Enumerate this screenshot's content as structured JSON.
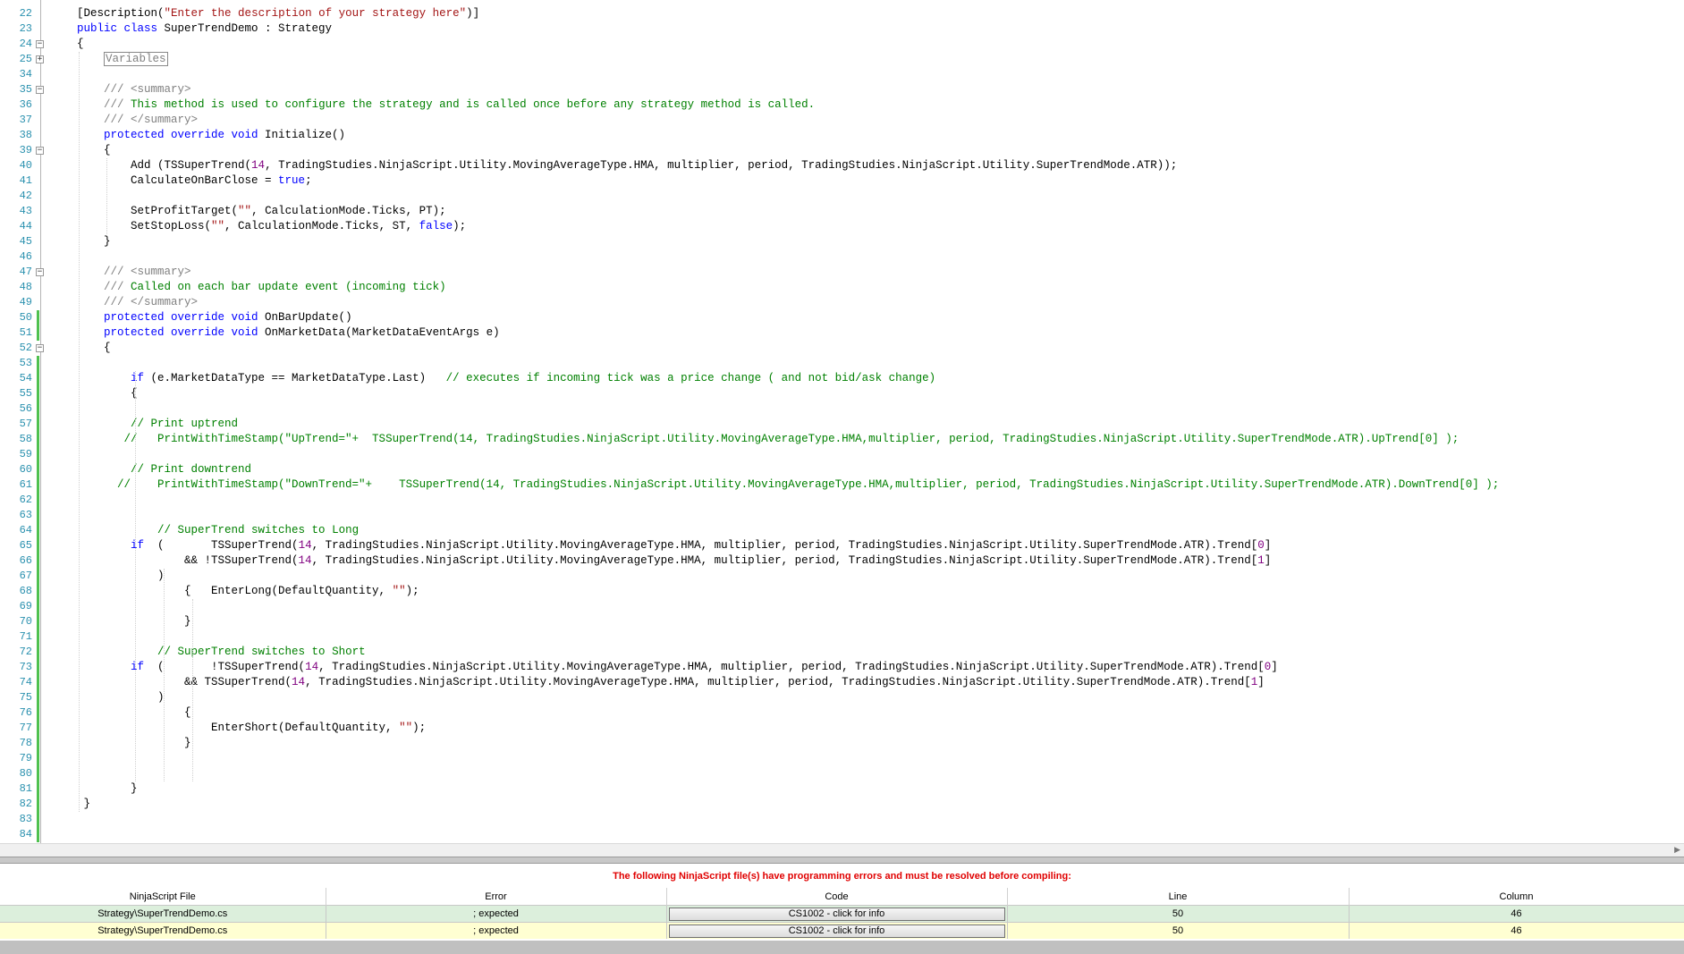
{
  "editor": {
    "lines": [
      {
        "n": "22",
        "parts": [
          [
            "",
            "    "
          ],
          [
            "",
            "[Description("
          ],
          [
            "st",
            "\"Enter the description of your strategy here\""
          ],
          [
            "",
            ")]"
          ]
        ]
      },
      {
        "n": "23",
        "parts": [
          [
            "",
            "    "
          ],
          [
            "kw",
            "public class"
          ],
          [
            "",
            " SuperTrendDemo : Strategy"
          ]
        ]
      },
      {
        "n": "24",
        "parts": [
          [
            "",
            "    {"
          ]
        ]
      },
      {
        "n": "25",
        "region": "Variables",
        "parts": [
          [
            "",
            "        "
          ]
        ]
      },
      {
        "n": "34",
        "parts": [
          [
            "",
            ""
          ]
        ]
      },
      {
        "n": "35",
        "parts": [
          [
            "",
            "        "
          ],
          [
            "gray",
            "/// <summary>"
          ]
        ]
      },
      {
        "n": "36",
        "parts": [
          [
            "",
            "        "
          ],
          [
            "gray",
            "/// "
          ],
          [
            "cm",
            "This method is used to configure the strategy and is called once before any strategy method is called."
          ]
        ]
      },
      {
        "n": "37",
        "parts": [
          [
            "",
            "        "
          ],
          [
            "gray",
            "/// </summary>"
          ]
        ]
      },
      {
        "n": "38",
        "parts": [
          [
            "",
            "        "
          ],
          [
            "kw",
            "protected override void"
          ],
          [
            "",
            " Initialize()"
          ]
        ]
      },
      {
        "n": "39",
        "parts": [
          [
            "",
            "        {"
          ]
        ]
      },
      {
        "n": "40",
        "parts": [
          [
            "",
            "            Add (TSSuperTrend("
          ],
          [
            "nm",
            "14"
          ],
          [
            "",
            ", TradingStudies.NinjaScript.Utility.MovingAverageType.HMA, multiplier, period, TradingStudies.NinjaScript.Utility.SuperTrendMode.ATR));"
          ]
        ]
      },
      {
        "n": "41",
        "parts": [
          [
            "",
            "            CalculateOnBarClose = "
          ],
          [
            "kw",
            "true"
          ],
          [
            "",
            ";"
          ]
        ]
      },
      {
        "n": "42",
        "parts": [
          [
            "",
            ""
          ]
        ]
      },
      {
        "n": "43",
        "parts": [
          [
            "",
            "            SetProfitTarget("
          ],
          [
            "st",
            "\"\""
          ],
          [
            "",
            ", CalculationMode.Ticks, PT);"
          ]
        ]
      },
      {
        "n": "44",
        "parts": [
          [
            "",
            "            SetStopLoss("
          ],
          [
            "st",
            "\"\""
          ],
          [
            "",
            ", CalculationMode.Ticks, ST, "
          ],
          [
            "kw",
            "false"
          ],
          [
            "",
            ");"
          ]
        ]
      },
      {
        "n": "45",
        "parts": [
          [
            "",
            "        }"
          ]
        ]
      },
      {
        "n": "46",
        "parts": [
          [
            "",
            ""
          ]
        ]
      },
      {
        "n": "47",
        "parts": [
          [
            "",
            "        "
          ],
          [
            "gray",
            "/// <summary>"
          ]
        ]
      },
      {
        "n": "48",
        "parts": [
          [
            "",
            "        "
          ],
          [
            "gray",
            "/// "
          ],
          [
            "cm",
            "Called on each bar update event (incoming tick)"
          ]
        ]
      },
      {
        "n": "49",
        "parts": [
          [
            "",
            "        "
          ],
          [
            "gray",
            "/// </summary>"
          ]
        ]
      },
      {
        "n": "50",
        "parts": [
          [
            "",
            "        "
          ],
          [
            "kw",
            "protected override void"
          ],
          [
            "",
            " OnBarUpdate()"
          ]
        ]
      },
      {
        "n": "51",
        "parts": [
          [
            "",
            "        "
          ],
          [
            "kw",
            "protected override void"
          ],
          [
            "",
            " OnMarketData(MarketDataEventArgs e)"
          ]
        ]
      },
      {
        "n": "52",
        "parts": [
          [
            "",
            "        {"
          ]
        ]
      },
      {
        "n": "53",
        "parts": [
          [
            "",
            ""
          ]
        ]
      },
      {
        "n": "54",
        "parts": [
          [
            "",
            "            "
          ],
          [
            "kw",
            "if"
          ],
          [
            "",
            " (e.MarketDataType == MarketDataType.Last)   "
          ],
          [
            "cm",
            "// executes if incoming tick was a price change ( and not bid/ask change)"
          ]
        ]
      },
      {
        "n": "55",
        "parts": [
          [
            "",
            "            {"
          ]
        ]
      },
      {
        "n": "56",
        "parts": [
          [
            "",
            ""
          ]
        ]
      },
      {
        "n": "57",
        "parts": [
          [
            "",
            "            "
          ],
          [
            "cm",
            "// Print uptrend"
          ]
        ]
      },
      {
        "n": "58",
        "parts": [
          [
            "",
            "           "
          ],
          [
            "cm",
            "//   PrintWithTimeStamp(\"UpTrend=\"+  TSSuperTrend(14, TradingStudies.NinjaScript.Utility.MovingAverageType.HMA,multiplier, period, TradingStudies.NinjaScript.Utility.SuperTrendMode.ATR).UpTrend[0] );"
          ]
        ]
      },
      {
        "n": "59",
        "parts": [
          [
            "",
            ""
          ]
        ]
      },
      {
        "n": "60",
        "parts": [
          [
            "",
            "            "
          ],
          [
            "cm",
            "// Print downtrend"
          ]
        ]
      },
      {
        "n": "61",
        "parts": [
          [
            "",
            "          "
          ],
          [
            "cm",
            "//    PrintWithTimeStamp(\"DownTrend=\"+    TSSuperTrend(14, TradingStudies.NinjaScript.Utility.MovingAverageType.HMA,multiplier, period, TradingStudies.NinjaScript.Utility.SuperTrendMode.ATR).DownTrend[0] );"
          ]
        ]
      },
      {
        "n": "62",
        "parts": [
          [
            "",
            ""
          ]
        ]
      },
      {
        "n": "63",
        "parts": [
          [
            "",
            ""
          ]
        ]
      },
      {
        "n": "64",
        "parts": [
          [
            "",
            "                "
          ],
          [
            "cm",
            "// SuperTrend switches to Long"
          ]
        ]
      },
      {
        "n": "65",
        "parts": [
          [
            "",
            "            "
          ],
          [
            "kw",
            "if"
          ],
          [
            "",
            "  (       TSSuperTrend("
          ],
          [
            "nm",
            "14"
          ],
          [
            "",
            ", TradingStudies.NinjaScript.Utility.MovingAverageType.HMA, multiplier, period, TradingStudies.NinjaScript.Utility.SuperTrendMode.ATR).Trend["
          ],
          [
            "nm",
            "0"
          ],
          [
            "",
            "]"
          ]
        ]
      },
      {
        "n": "66",
        "parts": [
          [
            "",
            "                    && !TSSuperTrend("
          ],
          [
            "nm",
            "14"
          ],
          [
            "",
            ", TradingStudies.NinjaScript.Utility.MovingAverageType.HMA, multiplier, period, TradingStudies.NinjaScript.Utility.SuperTrendMode.ATR).Trend["
          ],
          [
            "nm",
            "1"
          ],
          [
            "",
            "]"
          ]
        ]
      },
      {
        "n": "67",
        "parts": [
          [
            "",
            "                )"
          ]
        ]
      },
      {
        "n": "68",
        "parts": [
          [
            "",
            "                    {   EnterLong(DefaultQuantity, "
          ],
          [
            "st",
            "\"\""
          ],
          [
            "",
            ");"
          ]
        ]
      },
      {
        "n": "69",
        "parts": [
          [
            "",
            ""
          ]
        ]
      },
      {
        "n": "70",
        "parts": [
          [
            "",
            "                    }"
          ]
        ]
      },
      {
        "n": "71",
        "parts": [
          [
            "",
            ""
          ]
        ]
      },
      {
        "n": "72",
        "parts": [
          [
            "",
            "                "
          ],
          [
            "cm",
            "// SuperTrend switches to Short"
          ]
        ]
      },
      {
        "n": "73",
        "parts": [
          [
            "",
            "            "
          ],
          [
            "kw",
            "if"
          ],
          [
            "",
            "  (       !TSSuperTrend("
          ],
          [
            "nm",
            "14"
          ],
          [
            "",
            ", TradingStudies.NinjaScript.Utility.MovingAverageType.HMA, multiplier, period, TradingStudies.NinjaScript.Utility.SuperTrendMode.ATR).Trend["
          ],
          [
            "nm",
            "0"
          ],
          [
            "",
            "]"
          ]
        ]
      },
      {
        "n": "74",
        "parts": [
          [
            "",
            "                    && TSSuperTrend("
          ],
          [
            "nm",
            "14"
          ],
          [
            "",
            ", TradingStudies.NinjaScript.Utility.MovingAverageType.HMA, multiplier, period, TradingStudies.NinjaScript.Utility.SuperTrendMode.ATR).Trend["
          ],
          [
            "nm",
            "1"
          ],
          [
            "",
            "]"
          ]
        ]
      },
      {
        "n": "75",
        "parts": [
          [
            "",
            "                )"
          ]
        ]
      },
      {
        "n": "76",
        "parts": [
          [
            "",
            "                    {"
          ]
        ]
      },
      {
        "n": "77",
        "parts": [
          [
            "",
            "                        EnterShort(DefaultQuantity, "
          ],
          [
            "st",
            "\"\""
          ],
          [
            "",
            ");"
          ]
        ]
      },
      {
        "n": "78",
        "parts": [
          [
            "",
            "                    }"
          ]
        ]
      },
      {
        "n": "79",
        "parts": [
          [
            "",
            ""
          ]
        ]
      },
      {
        "n": "80",
        "parts": [
          [
            "",
            ""
          ]
        ]
      },
      {
        "n": "81",
        "parts": [
          [
            "",
            "            }"
          ]
        ]
      },
      {
        "n": "82",
        "parts": [
          [
            "",
            "     }"
          ]
        ]
      },
      {
        "n": "83",
        "parts": [
          [
            "",
            ""
          ]
        ]
      },
      {
        "n": "84",
        "parts": [
          [
            "",
            ""
          ]
        ]
      }
    ]
  },
  "errors": {
    "message": "The following NinjaScript file(s) have programming errors and must be resolved before compiling:",
    "columns": [
      "NinjaScript File",
      "Error",
      "Code",
      "Line",
      "Column"
    ],
    "rows": [
      {
        "file": "Strategy\\SuperTrendDemo.cs",
        "error": "; expected",
        "code": "CS1002 - click for info",
        "line": "50",
        "column": "46"
      },
      {
        "file": "Strategy\\SuperTrendDemo.cs",
        "error": "; expected",
        "code": "CS1002 - click for info",
        "line": "50",
        "column": "46"
      }
    ]
  }
}
